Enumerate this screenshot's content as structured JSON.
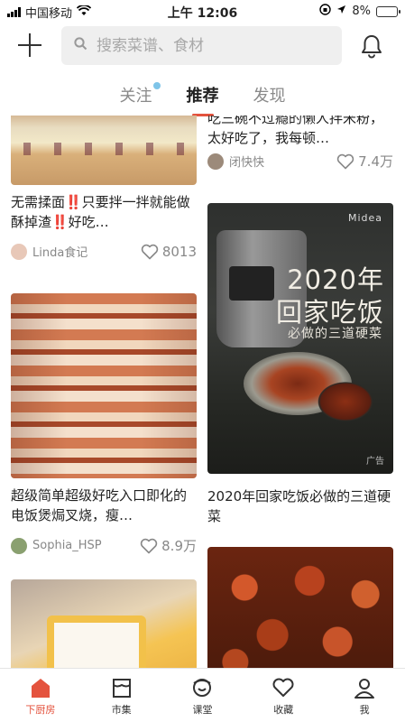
{
  "status_bar": {
    "carrier": "中国移动",
    "time": "上午 12:06",
    "battery": "8%",
    "battery_level": 0.08
  },
  "header": {
    "search_placeholder": "搜索菜谱、食材"
  },
  "tabs": [
    {
      "label": "关注",
      "has_dot": true
    },
    {
      "label": "推荐",
      "active": true
    },
    {
      "label": "发现"
    }
  ],
  "feed": {
    "left": [
      {
        "title": "无需揉面‼️只要拌一拌就能做酥掉渣‼️好吃…",
        "author": "Linda食记",
        "likes": "8013"
      },
      {
        "title": "超级简单超级好吃入口即化的电饭煲焗叉烧，瘦…",
        "author": "Sophia_HSP",
        "likes": "8.9万"
      }
    ],
    "right": [
      {
        "title": "吃三碗不过瘾的懒人拌米粉，太好吃了，我每顿…",
        "author": "闭快快",
        "likes": "7.4万"
      },
      {
        "title": "2020年回家吃饭必做的三道硬菜",
        "ad": {
          "brand": "Midea",
          "line1": "2020年",
          "line2": "回家吃饭",
          "line3": "必做的三道硬菜",
          "tag": "广告"
        }
      }
    ]
  },
  "navbar": [
    {
      "label": "下厨房",
      "icon": "home-icon",
      "active": true
    },
    {
      "label": "市集",
      "icon": "market-icon"
    },
    {
      "label": "课堂",
      "icon": "class-icon"
    },
    {
      "label": "收藏",
      "icon": "heart-icon"
    },
    {
      "label": "我",
      "icon": "profile-icon"
    }
  ],
  "colors": {
    "accent": "#e4533e"
  }
}
